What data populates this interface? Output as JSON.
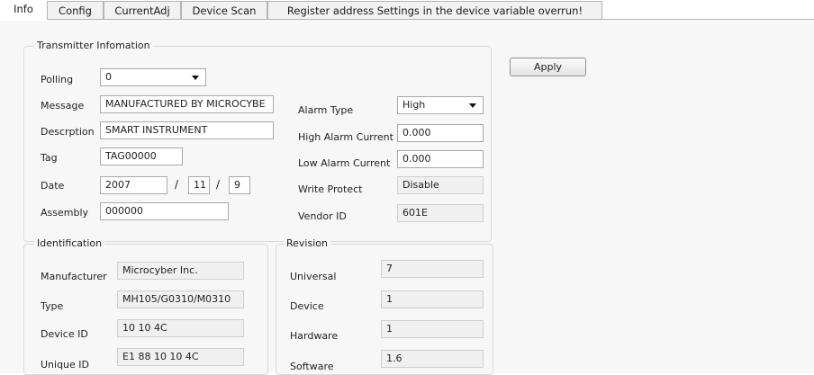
{
  "tabs": [
    "Info",
    "Config",
    "CurrentAdj",
    "Device Scan",
    "Register address Settings in the device variable overrun!"
  ],
  "transmitter": {
    "title": "Transmitter Infomation",
    "polling_label": "Polling",
    "polling_value": "0",
    "message_label": "Message",
    "message_value": "MANUFACTURED BY MICROCYBE",
    "description_label": "Descrption",
    "description_value": "SMART INSTRUMENT",
    "tag_label": "Tag",
    "tag_value": "TAG00000",
    "date_label": "Date",
    "date_year": "2007",
    "date_month": "11",
    "date_day": "9",
    "date_sep": "/",
    "assembly_label": "Assembly",
    "assembly_value": "000000",
    "alarm_type_label": "Alarm Type",
    "alarm_type_value": "High",
    "high_alarm_label": "High Alarm Current",
    "high_alarm_value": "0.000",
    "low_alarm_label": "Low Alarm Current",
    "low_alarm_value": "0.000",
    "write_protect_label": "Write Protect",
    "write_protect_value": "Disable",
    "vendor_id_label": "Vendor ID",
    "vendor_id_value": "601E"
  },
  "apply_label": "Apply",
  "identification": {
    "title": "Identification",
    "manufacturer_label": "Manufacturer",
    "manufacturer_value": "Microcyber Inc.",
    "type_label": "Type",
    "type_value": "MH105/G0310/M0310",
    "device_id_label": "Device ID",
    "device_id_value": "10 10 4C",
    "unique_id_label": "Unique ID",
    "unique_id_value": "E1 88 10 10 4C"
  },
  "revision": {
    "title": "Revision",
    "universal_label": "Universal",
    "universal_value": "7",
    "device_label": "Device",
    "device_value": "1",
    "hardware_label": "Hardware",
    "hardware_value": "1",
    "software_label": "Software",
    "software_value": "1.6"
  }
}
